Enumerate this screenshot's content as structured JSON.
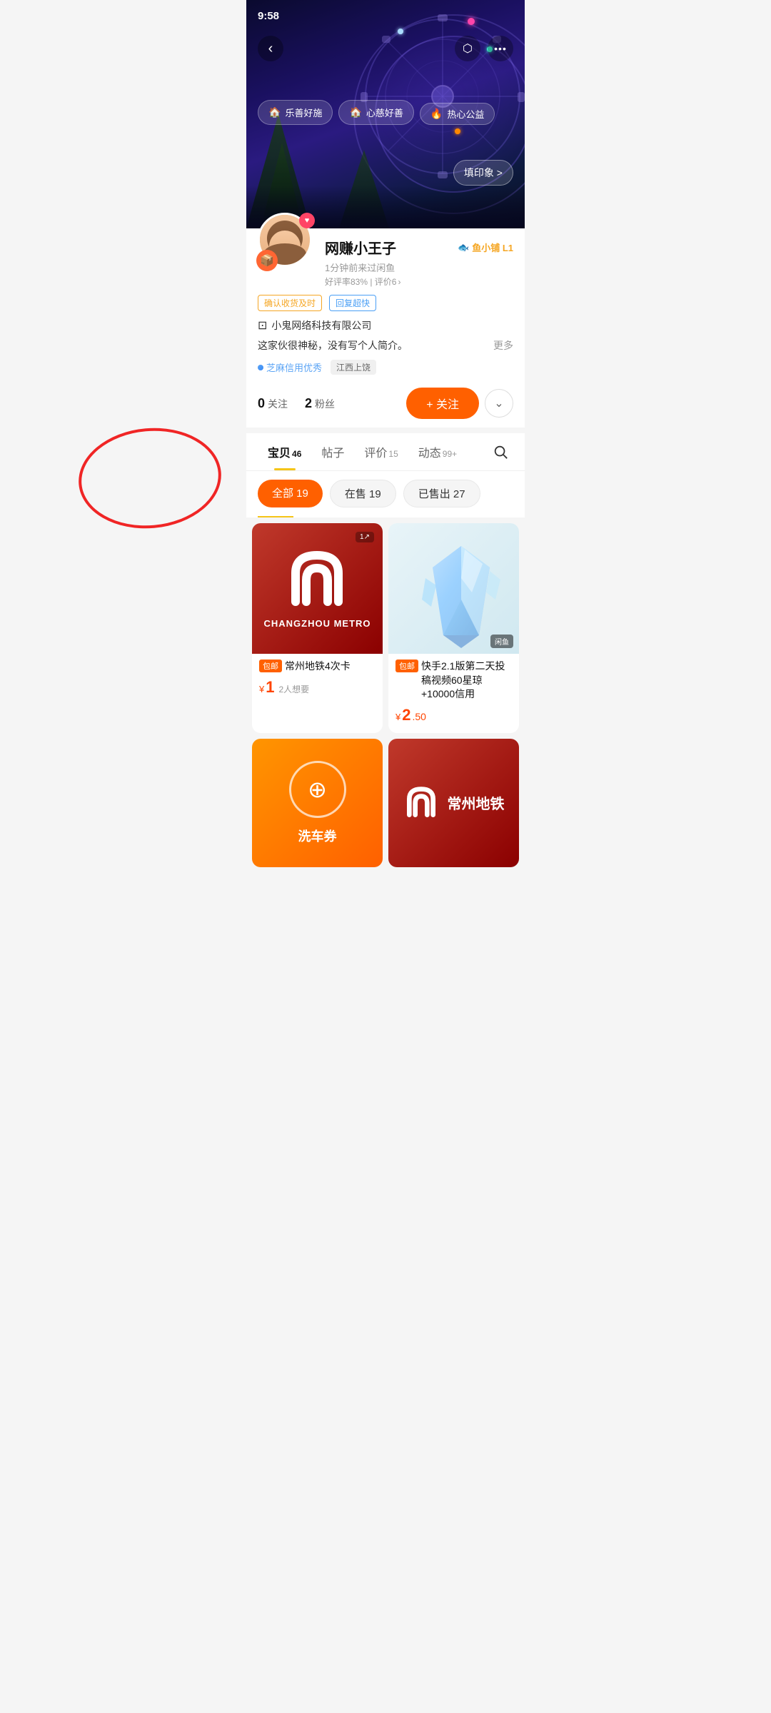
{
  "statusBar": {
    "time": "9:58"
  },
  "nav": {
    "backIcon": "←",
    "shareIcon": "↗",
    "moreIcon": "···"
  },
  "hero": {
    "badges": [
      {
        "icon": "🏠",
        "label": "乐善好施"
      },
      {
        "icon": "🏠",
        "label": "心慈好善"
      },
      {
        "icon": "🔥",
        "label": "热心公益"
      }
    ],
    "impressionBtn": "填印象 >"
  },
  "profile": {
    "name": "网赚小王子",
    "lastSeen": "1分钟前来过闲鱼",
    "shopBadge": "鱼小铺 L1",
    "rating": "好评率83% | 评价6",
    "tags": [
      "确认收货及时",
      "回复超快"
    ],
    "company": "小鬼网络科技有限公司",
    "bio": "这家伙很神秘，没有写个人简介。",
    "bioMore": "更多",
    "creditLabel": "芝麻信用优秀",
    "location": "江西上饶",
    "following": {
      "num": "0",
      "label": "关注"
    },
    "followers": {
      "num": "2",
      "label": "粉丝"
    },
    "followBtn": "+ 关注"
  },
  "tabs": [
    {
      "label": "宝贝",
      "count": "46",
      "active": true
    },
    {
      "label": "帖子",
      "count": "",
      "active": false
    },
    {
      "label": "评价",
      "count": "15",
      "active": false
    },
    {
      "label": "动态",
      "count": "99+",
      "active": false
    }
  ],
  "subTabs": [
    {
      "label": "全部 19",
      "active": true
    },
    {
      "label": "在售 19",
      "active": false
    },
    {
      "label": "已售出 27",
      "active": false
    }
  ],
  "products": [
    {
      "id": "metro-card",
      "badgeLabel": "包邮",
      "title": "常州地铁4次卡",
      "price": "1",
      "priceDecimal": "",
      "priceSuffix": "2人想要",
      "type": "metro"
    },
    {
      "id": "crystal",
      "badgeLabel": "包邮",
      "title": "快手2.1版第二天投稿视频60星琼+10000信用",
      "price": "2",
      "priceDecimal": ".50",
      "priceSuffix": "",
      "type": "crystal",
      "cornerBadge": "闲鱼"
    }
  ],
  "bottomCards": [
    {
      "type": "wash",
      "label": "洗车券",
      "icon": "⊙"
    },
    {
      "type": "metro2",
      "label": "常州地铁"
    }
  ]
}
